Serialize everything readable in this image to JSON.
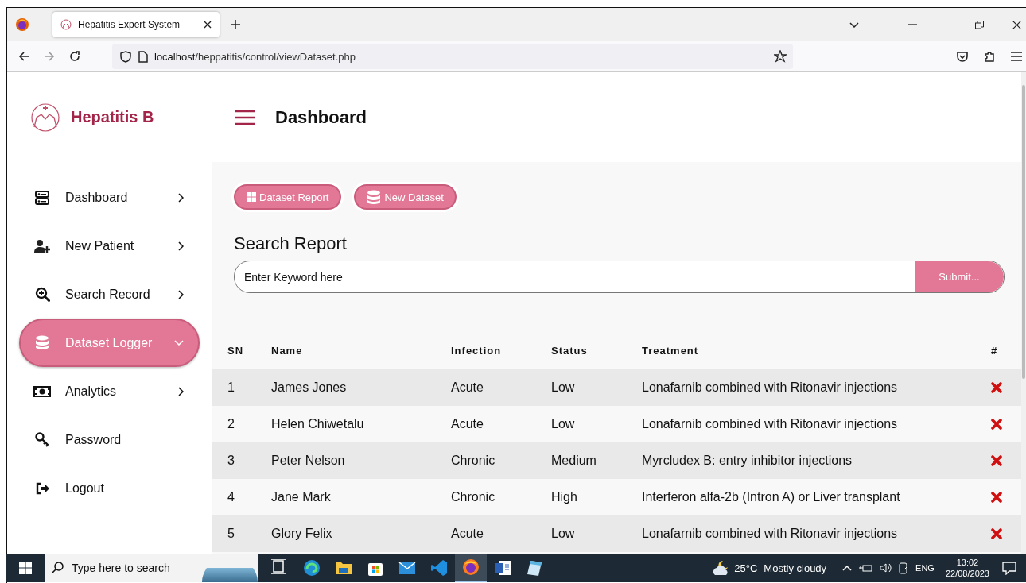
{
  "browser": {
    "tab_title": "Hepatitis Expert System",
    "url_host": "localhost",
    "url_path": "/heppatitis/control/viewDataset.php"
  },
  "sidebar": {
    "brand": "Hepatitis B",
    "items": [
      {
        "label": "Dashboard",
        "kind": "submenu",
        "selected": false,
        "expanded": false
      },
      {
        "label": "New Patient",
        "kind": "submenu",
        "selected": false,
        "expanded": false
      },
      {
        "label": "Search Record",
        "kind": "submenu",
        "selected": false,
        "expanded": false
      },
      {
        "label": "Dataset Logger",
        "kind": "submenu",
        "selected": true,
        "expanded": true
      },
      {
        "label": "Analytics",
        "kind": "submenu",
        "selected": false,
        "expanded": false
      },
      {
        "label": "Password",
        "kind": "link",
        "selected": false
      },
      {
        "label": "Logout",
        "kind": "link",
        "selected": false
      }
    ]
  },
  "header": {
    "title": "Dashboard"
  },
  "actions": [
    "Dataset Report",
    "New Dataset"
  ],
  "search": {
    "heading": "Search Report",
    "placeholder": "Enter Keyword here",
    "submit": "Submit..."
  },
  "table": {
    "columns": [
      "SN",
      "Name",
      "Infection",
      "Status",
      "Treatment",
      "#"
    ],
    "rows": [
      [
        "1",
        "James Jones",
        "Acute",
        "Low",
        "Lonafarnib combined with Ritonavir injections"
      ],
      [
        "2",
        "Helen Chiwetalu",
        "Acute",
        "Low",
        "Lonafarnib combined with Ritonavir injections"
      ],
      [
        "3",
        "Peter Nelson",
        "Chronic",
        "Medium",
        "Myrcludex B: entry inhibitor injections"
      ],
      [
        "4",
        "Jane Mark",
        "Chronic",
        "High",
        "Interferon alfa-2b (Intron A) or Liver transplant"
      ],
      [
        "5",
        "Glory Felix",
        "Acute",
        "Low",
        "Lonafarnib combined with Ritonavir injections"
      ]
    ]
  },
  "taskbar": {
    "search_placeholder": "Type here to search",
    "apps": [
      {
        "selected": false
      },
      {
        "selected": false
      },
      {
        "selected": false
      },
      {
        "selected": false
      },
      {
        "selected": false
      },
      {
        "selected": false
      },
      {
        "selected": true
      },
      {
        "selected": false
      },
      {
        "selected": false
      }
    ],
    "temperature": "25°C",
    "weather": "Mostly cloudy",
    "language": "ENG",
    "time": "13:02",
    "date": "22/08/2023"
  }
}
